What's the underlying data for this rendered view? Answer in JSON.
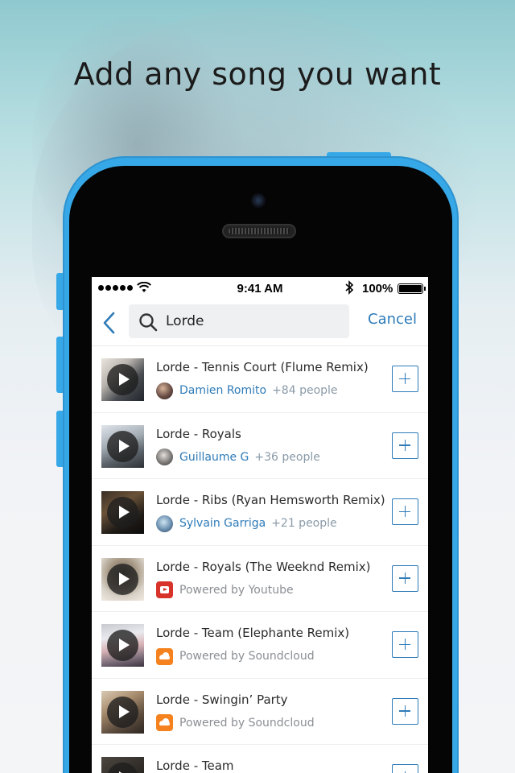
{
  "headline": "Add any song you want",
  "status_bar": {
    "time": "9:41 AM",
    "battery": "100%",
    "bluetooth_icon": "bluetooth-icon"
  },
  "search": {
    "query": "Lorde",
    "cancel_label": "Cancel",
    "back_icon": "chevron-left-icon",
    "search_icon": "search-icon"
  },
  "colors": {
    "accent": "#2e7bb8",
    "phone_body": "#36a8e8",
    "youtube": "#d8332a",
    "soundcloud": "#f5821f"
  },
  "results": [
    {
      "title": "Lorde - Tennis Court (Flume Remix)",
      "type": "user",
      "user": "Damien Romito",
      "people": "+84 people",
      "thumb": "linear-gradient(135deg,#e9e4dc 0%,#b9b4ae 35%,#4a4d52 65%,#20252b 100%)",
      "avatar": "radial-gradient(circle at 40% 35%,#d7b49a 0%,#6a4e46 55%,#2b2320 100%)"
    },
    {
      "title": "Lorde - Royals",
      "type": "user",
      "user": "Guillaume G",
      "people": "+36 people",
      "thumb": "linear-gradient(160deg,#dfe4ea 0%,#a5adb5 40%,#5a6168 70%,#2d3136 100%)",
      "avatar": "radial-gradient(circle at 45% 40%,#e2dfdc 0%,#7d7a78 55%,#2f2e2d 100%)"
    },
    {
      "title": "Lorde - Ribs (Ryan Hemsworth Remix)",
      "type": "user",
      "user": "Sylvain Garriga",
      "people": "+21 people",
      "thumb": "linear-gradient(150deg,#3a2f24 0%,#6a5238 35%,#1f1b17 70%,#0d0c0b 100%)",
      "avatar": "radial-gradient(circle at 45% 40%,#cfe4f0 0%,#6a8fb0 55%,#2f3f52 100%)"
    },
    {
      "title": "Lorde - Royals (The Weeknd Remix)",
      "type": "source",
      "source": "youtube",
      "powered": "Powered by Youtube",
      "thumb": "radial-gradient(circle at 50% 35%,#6b6257 0%,#a89a86 40%,#d8d2c8 70%,#efe9e0 100%)"
    },
    {
      "title": "Lorde - Team (Elephante Remix)",
      "type": "source",
      "source": "soundcloud",
      "powered": "Powered by Soundcloud",
      "thumb": "linear-gradient(170deg,#c7c9d0 0%,#e9eaee 30%,#d7b2b6 55%,#7a6c78 80%,#3b3440 100%)"
    },
    {
      "title": "Lorde - Swingin’ Party",
      "type": "source",
      "source": "soundcloud",
      "powered": "Powered by Soundcloud",
      "thumb": "linear-gradient(150deg,#d9cab4 0%,#a88d6e 35%,#5a4a3c 70%,#2e2722 100%)"
    },
    {
      "title": "Lorde - Team",
      "type": "partial",
      "thumb": "linear-gradient(150deg,#4b4640 0%,#2a2622 60%,#151311 100%)"
    }
  ]
}
